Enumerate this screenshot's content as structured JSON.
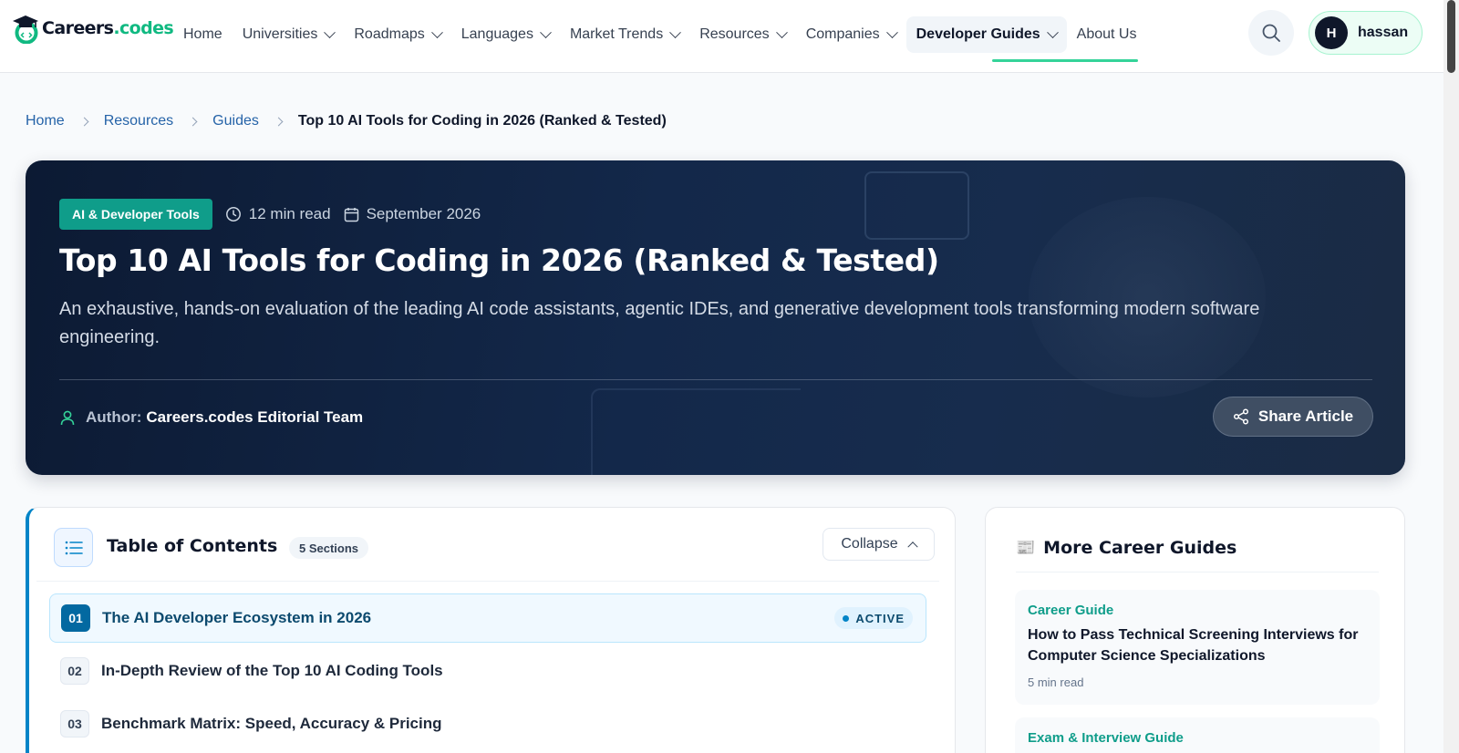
{
  "brand": {
    "name_part1": "Careers",
    "name_part2": ".codes"
  },
  "nav": {
    "items": [
      {
        "label": "Home",
        "dropdown": false
      },
      {
        "label": "Universities",
        "dropdown": true
      },
      {
        "label": "Roadmaps",
        "dropdown": true
      },
      {
        "label": "Languages",
        "dropdown": true
      },
      {
        "label": "Market Trends",
        "dropdown": true
      },
      {
        "label": "Resources",
        "dropdown": true
      },
      {
        "label": "Companies",
        "dropdown": true
      },
      {
        "label": "Developer Guides",
        "dropdown": true,
        "active": true
      },
      {
        "label": "About Us",
        "dropdown": false
      }
    ],
    "search_icon": "search-icon",
    "user": {
      "initial": "H",
      "name": "hassan"
    }
  },
  "breadcrumb": {
    "items": [
      "Home",
      "Resources",
      "Guides"
    ],
    "current": "Top 10 AI Tools for Coding in 2026 (Ranked & Tested)"
  },
  "hero": {
    "tag": "AI & Developer Tools",
    "read_time": "12 min read",
    "date": "September 2026",
    "title": "Top 10 AI Tools for Coding in 2026 (Ranked & Tested)",
    "subtitle": "An exhaustive, hands-on evaluation of the leading AI code assistants, agentic IDEs, and generative development tools transforming modern software engineering.",
    "author_label": "Author:",
    "author_name": "Careers.codes Editorial Team",
    "share_label": "Share Article"
  },
  "toc": {
    "title": "Table of Contents",
    "count_label": "5 Sections",
    "collapse_label": "Collapse",
    "active_label": "ACTIVE",
    "items": [
      {
        "num": "01",
        "label": "The AI Developer Ecosystem in 2026",
        "active": true
      },
      {
        "num": "02",
        "label": "In-Depth Review of the Top 10 AI Coding Tools",
        "active": false
      },
      {
        "num": "03",
        "label": "Benchmark Matrix: Speed, Accuracy & Pricing",
        "active": false
      }
    ]
  },
  "sidebar": {
    "icon": "📰",
    "title": "More Career Guides",
    "guides": [
      {
        "category": "Career Guide",
        "title": "How to Pass Technical Screening Interviews for Computer Science Specializations",
        "read_time": "5 min read"
      },
      {
        "category": "Exam & Interview Guide",
        "title": "",
        "read_time": ""
      }
    ]
  },
  "colors": {
    "accent": "#10b981",
    "primary": "#0284c7",
    "hero_bg": "#0c1a33",
    "tag": "#0f9d8a"
  }
}
